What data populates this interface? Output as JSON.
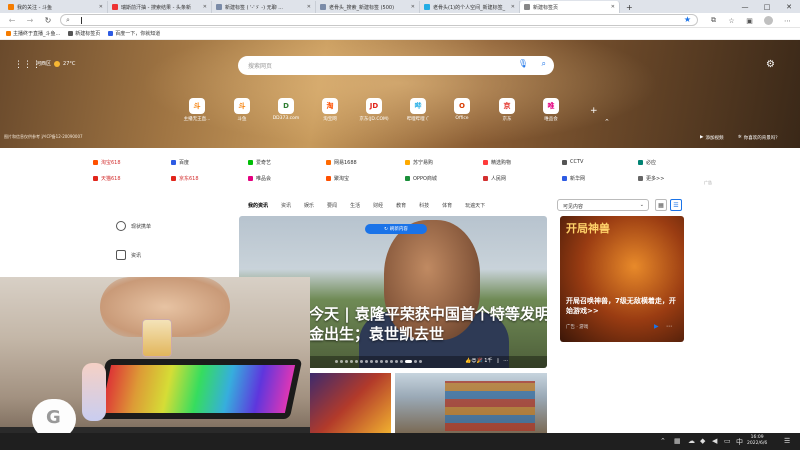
{
  "tabs": [
    {
      "label": "我的关注 - 斗鱼",
      "active": false
    },
    {
      "label": "瑞斯前汗抽 - 搜索结果 - 头条新",
      "active": false
    },
    {
      "label": "新建标签 ( '-'ゞ -) 无聊 ...",
      "active": false
    },
    {
      "label": "老骨头_搜索_新建标签 (500)",
      "active": false
    },
    {
      "label": "老骨头(1)的个人空间_新建标签_",
      "active": false
    },
    {
      "label": "新建标签页",
      "active": true
    }
  ],
  "window_controls": {
    "minimize": "—",
    "maximize": "□",
    "close": "✕"
  },
  "toolbar": {
    "back": "←",
    "forward": "→",
    "refresh": "↻",
    "address_value": ""
  },
  "bookmarks": [
    {
      "label": "主播终于直播_斗鱼...",
      "color": "#f57c00"
    },
    {
      "label": "新建标签页",
      "color": "#555555"
    },
    {
      "label": "百度一下，你就知道",
      "color": "#2d5be3"
    }
  ],
  "hero": {
    "location": "河西区",
    "temperature": "27°C",
    "search_placeholder": "搜索网页",
    "footer_text": "图片和信息仅供参考 沪ICP备12-20090007",
    "link_motion": "添加视频",
    "link_like": "你喜欢的背景吗？"
  },
  "quick_tiles": [
    {
      "label": "主播无王直...",
      "glyph": "斗",
      "color": "#f57c00"
    },
    {
      "label": "斗鱼",
      "glyph": "斗",
      "color": "#f57c00"
    },
    {
      "label": "DD373.com",
      "glyph": "D",
      "color": "#2e7d32"
    },
    {
      "label": "淘宝网",
      "glyph": "淘",
      "color": "#ff5000"
    },
    {
      "label": "京东(JD.COM)",
      "glyph": "JD",
      "color": "#e1251b"
    },
    {
      "label": "哔哩哔哩 ( ̄",
      "glyph": "哔",
      "color": "#23ade5"
    },
    {
      "label": "Office",
      "glyph": "O",
      "color": "#d83b01"
    },
    {
      "label": "京东",
      "glyph": "京",
      "color": "#e1251b"
    },
    {
      "label": "唯品会",
      "glyph": "唯",
      "color": "#e4007f"
    }
  ],
  "link_grid": [
    [
      {
        "label": "淘宝618",
        "color": "#ff5000",
        "red": true
      },
      {
        "label": "百度",
        "color": "#2d5be3",
        "red": false
      },
      {
        "label": "爱奇艺",
        "color": "#00be06",
        "red": false
      },
      {
        "label": "网易1688",
        "color": "#ff6a00",
        "red": false
      },
      {
        "label": "苏宁易购",
        "color": "#ffaa00",
        "red": false
      },
      {
        "label": "精选购物",
        "color": "#ff3b3b",
        "red": false
      },
      {
        "label": "CCTV",
        "color": "#555555",
        "red": false
      },
      {
        "label": "必应",
        "color": "#008373",
        "red": false
      }
    ],
    [
      {
        "label": "天猫618",
        "color": "#e1251b",
        "red": true
      },
      {
        "label": "京东618",
        "color": "#e1251b",
        "red": true
      },
      {
        "label": "唯品会",
        "color": "#e4007f",
        "red": false
      },
      {
        "label": "聚淘宝",
        "color": "#ff5000",
        "red": false
      },
      {
        "label": "OPPO商城",
        "color": "#1b8f3a",
        "red": false
      },
      {
        "label": "人民网",
        "color": "#d32f2f",
        "red": false
      },
      {
        "label": "新华网",
        "color": "#2d5be3",
        "red": false
      },
      {
        "label": "更多>>",
        "color": "#666666",
        "red": false
      }
    ]
  ],
  "ad_mark": "广告",
  "sidebar": [
    {
      "label": "现状携单"
    },
    {
      "label": "资讯"
    }
  ],
  "news_tabs": [
    "我的资讯",
    "资讯",
    "娱乐",
    "要闻",
    "生活",
    "财经",
    "教育",
    "科技",
    "体育",
    "玩遍天下"
  ],
  "content_select": "可见内容",
  "view_grid": "▦",
  "view_list": "☰",
  "big_card": {
    "refresh_label": "刷新内容",
    "headline_line1": "今天 | 袁隆平荣获中国首个特等发明",
    "headline_line2": "金出生；袁世凯去世",
    "reactions": "👍😍🎉 1千"
  },
  "ad_card": {
    "title": "开局神兽",
    "text": "开局召唤神兽，7级无敌横着走，开始游戏>>",
    "meta": "广告 · 游戏"
  },
  "taskbar": {
    "time": "16:09",
    "date": "2022/6/6"
  }
}
